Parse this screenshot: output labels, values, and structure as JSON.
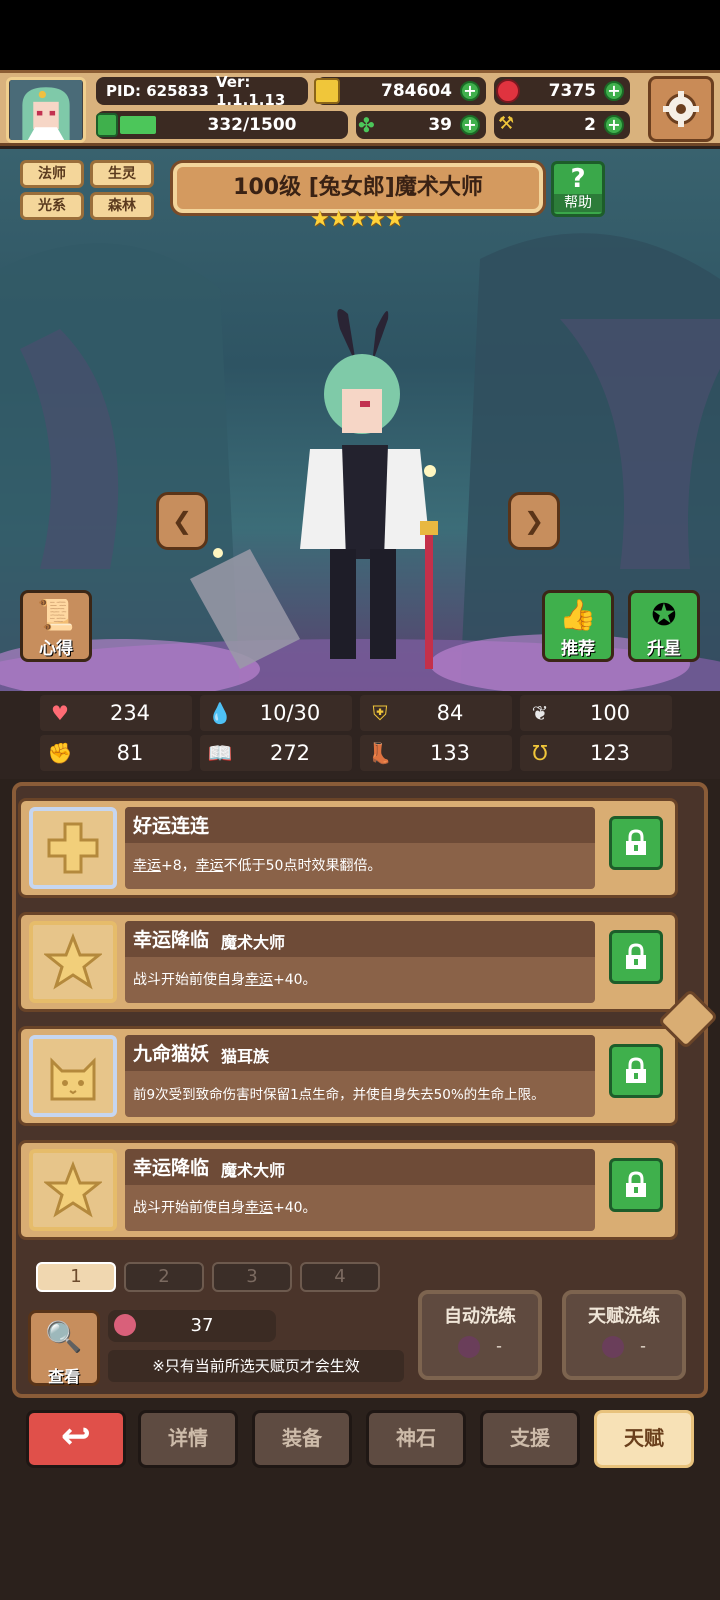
{
  "header": {
    "pid": "PID: 625833",
    "version": "Ver: 1.1.1.13",
    "gold": "784604",
    "gems": "7375",
    "stamina": "332/1500",
    "clover": "39",
    "hammer": "2",
    "stamina_fraction": 0.22
  },
  "hero": {
    "tags": [
      "法师",
      "生灵",
      "光系",
      "森林"
    ],
    "title": "100级 [兔女郎]魔术大师",
    "stars": "★★★★★",
    "help_label": "帮助",
    "insight_label": "心得",
    "recommend_label": "推荐",
    "starup_label": "升星"
  },
  "stats": {
    "hp": "234",
    "mana": "10/30",
    "defense": "84",
    "speed": "100",
    "attack": "81",
    "magic": "272",
    "crit": "133",
    "luck": "123"
  },
  "talents": [
    {
      "name": "好运连连",
      "sub": "",
      "desc_pre": "幸运",
      "desc_mid": "+8，",
      "desc_ul": "幸运",
      "desc_post": "不低于50点时效果翻倍。",
      "icon": "cross-icon"
    },
    {
      "name": "幸运降临",
      "sub": "魔术大师",
      "desc_pre": "战斗开始前使自身",
      "desc_mid": "",
      "desc_ul": "幸运",
      "desc_post": "+40。",
      "icon": "star-icon"
    },
    {
      "name": "九命猫妖",
      "sub": "猫耳族",
      "desc_pre": "前9次受到致命伤害时保留1点生命，并使自身失去50%的生命上限。",
      "desc_mid": "",
      "desc_ul": "",
      "desc_post": "",
      "icon": "cat-icon"
    },
    {
      "name": "幸运降临",
      "sub": "魔术大师",
      "desc_pre": "战斗开始前使自身",
      "desc_mid": "",
      "desc_ul": "幸运",
      "desc_post": "+40。",
      "icon": "star-icon"
    }
  ],
  "pages": [
    "1",
    "2",
    "3",
    "4"
  ],
  "bottom": {
    "view_label": "查看",
    "fruit_count": "37",
    "note": "※只有当前所选天赋页才会生效",
    "auto_wash": "自动洗练",
    "auto_wash_cost": "-",
    "talent_wash": "天赋洗练",
    "talent_wash_cost": "-"
  },
  "nav": {
    "back": "↩",
    "details": "详情",
    "equipment": "装备",
    "godstone": "神石",
    "support": "支援",
    "talent": "天赋"
  },
  "colors": {
    "accent_green": "#3fb04c",
    "panel_brown": "#4a342a",
    "card_tan": "#d9ad73",
    "back_red": "#e0504a"
  }
}
